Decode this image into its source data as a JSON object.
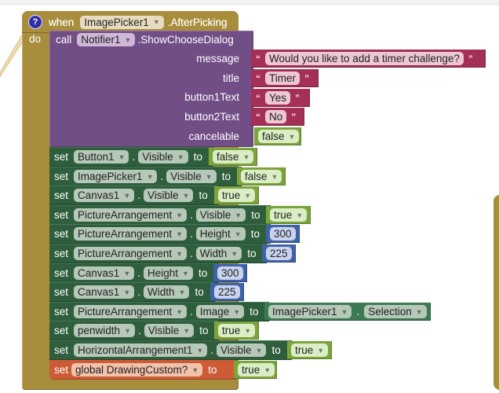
{
  "event": {
    "when_label": "when",
    "component": "ImagePicker1",
    "event_name": ".AfterPicking",
    "do_label": "do",
    "help_icon": "?"
  },
  "notifier_call": {
    "call_label": "call",
    "component": "Notifier1",
    "method": ".ShowChooseDialog",
    "args": [
      {
        "label": "message",
        "type": "text",
        "value": "Would you like to add a timer challenge?"
      },
      {
        "label": "title",
        "type": "text",
        "value": "Timer"
      },
      {
        "label": "button1Text",
        "type": "text",
        "value": "Yes"
      },
      {
        "label": "button2Text",
        "type": "text",
        "value": "No"
      },
      {
        "label": "cancelable",
        "type": "boolean",
        "value": "false"
      }
    ],
    "open_quote": "“",
    "close_quote": "”"
  },
  "set_label": "set",
  "to_label": "to",
  "dot_label": ".",
  "statements": [
    {
      "component": "Button1",
      "property": "Visible",
      "value": "false",
      "value_type": "boolean"
    },
    {
      "component": "ImagePicker1",
      "property": "Visible",
      "value": "false",
      "value_type": "boolean"
    },
    {
      "component": "Canvas1",
      "property": "Visible",
      "value": "true",
      "value_type": "boolean"
    },
    {
      "component": "PictureArrangement",
      "property": "Visible",
      "value": "true",
      "value_type": "boolean"
    },
    {
      "component": "PictureArrangement",
      "property": "Height",
      "value": "300",
      "value_type": "number"
    },
    {
      "component": "PictureArrangement",
      "property": "Width",
      "value": "225",
      "value_type": "number"
    },
    {
      "component": "Canvas1",
      "property": "Height",
      "value": "300",
      "value_type": "number"
    },
    {
      "component": "Canvas1",
      "property": "Width",
      "value": "225",
      "value_type": "number"
    },
    {
      "component": "PictureArrangement",
      "property": "Image",
      "value_component": "ImagePicker1",
      "value_property": "Selection",
      "value_type": "getter"
    },
    {
      "component": "penwidth",
      "property": "Visible",
      "value": "true",
      "value_type": "boolean"
    },
    {
      "component": "HorizontalArrangement1",
      "property": "Visible",
      "value": "true",
      "value_type": "boolean"
    }
  ],
  "global_set": {
    "variable": "global DrawingCustom?",
    "value": "true"
  },
  "colors": {
    "event": "#a88d3d",
    "procedure": "#714e86",
    "component_set": "#2f5e3c",
    "text": "#a43055",
    "logic": "#7ca33c",
    "math": "#3f63a6",
    "variable": "#cd5b36"
  }
}
